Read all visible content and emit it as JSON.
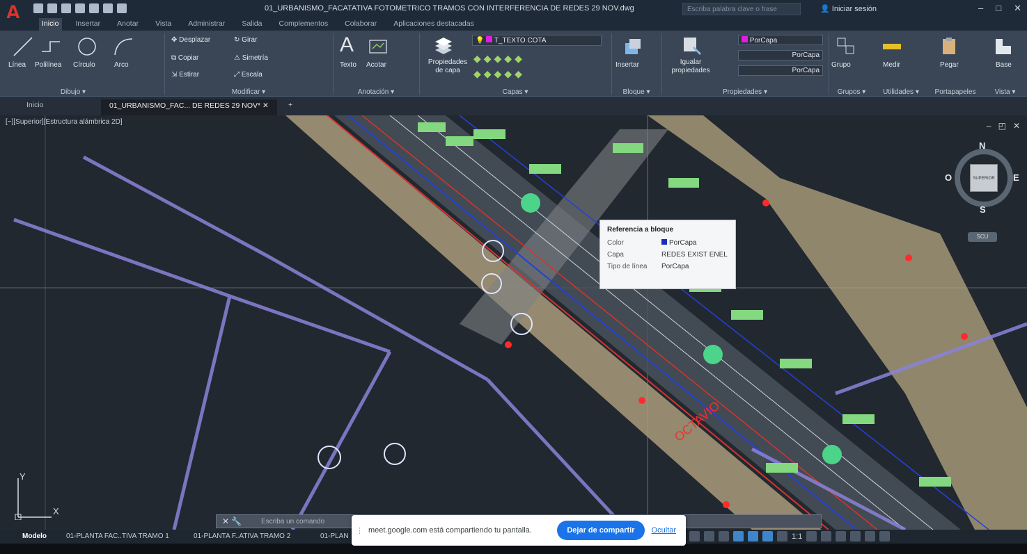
{
  "title_bar": {
    "document_title": "01_URBANISMO_FACATATIVA FOTOMETRICO TRAMOS CON INTERFERENCIA DE REDES 29 NOV.dwg",
    "search_placeholder": "Escriba palabra clave o frase",
    "signin_label": "Iniciar sesión"
  },
  "ribbon_tabs": [
    "Inicio",
    "Insertar",
    "Anotar",
    "Vista",
    "Administrar",
    "Salida",
    "Complementos",
    "Colaborar",
    "Aplicaciones destacadas"
  ],
  "ribbon": {
    "dibujo": {
      "title": "Dibujo ▾",
      "linea": "Línea",
      "polilinea": "Polilínea",
      "circulo": "Círculo",
      "arco": "Arco"
    },
    "modificar": {
      "title": "Modificar ▾",
      "desplazar": "Desplazar",
      "girar": "Girar",
      "copiar": "Copiar",
      "simetria": "Simetría",
      "estirar": "Estirar",
      "escala": "Escala"
    },
    "anotacion": {
      "title": "Anotación ▾",
      "texto": "Texto",
      "acotar": "Acotar"
    },
    "capas": {
      "title": "Capas ▾",
      "propiedades": "Propiedades de capa",
      "current_layer": "T_TEXTO COTA"
    },
    "bloque": {
      "title": "Bloque ▾",
      "insertar": "Insertar"
    },
    "propiedades": {
      "title": "Propiedades ▾",
      "igualar": "Igualar propiedades",
      "color": "PorCapa",
      "linetype": "PorCapa",
      "lineweight": "PorCapa"
    },
    "grupos": {
      "title": "Grupos ▾",
      "grupo": "Grupo"
    },
    "utilidades": {
      "title": "Utilidades ▾",
      "medir": "Medir"
    },
    "portapapeles": {
      "title": "Portapapeles",
      "pegar": "Pegar"
    },
    "vista": {
      "title": "Vista ▾",
      "base": "Base"
    }
  },
  "file_tabs": {
    "home": "Inicio",
    "active": "01_URBANISMO_FAC... DE REDES 29 NOV*"
  },
  "viewport": {
    "label": "[−][Superior][Estructura alámbrica 2D]",
    "compass": {
      "north": "N",
      "south": "S",
      "east": "E",
      "west": "O",
      "cube": "SUPERIOR",
      "wcs": "SCU"
    },
    "ucs_y": "Y",
    "ucs_x": "X"
  },
  "tooltip": {
    "title": "Referencia a bloque",
    "rows": [
      {
        "key": "Color",
        "value": "PorCapa"
      },
      {
        "key": "Capa",
        "value": "REDES EXIST ENEL"
      },
      {
        "key": "Tipo de línea",
        "value": "PorCapa"
      }
    ]
  },
  "command_line": {
    "placeholder": "Escriba un comando"
  },
  "layout_tabs": [
    "Modelo",
    "01-PLANTA FAC..TIVA TRAMO 1",
    "01-PLANTA F..ATIVA TRAMO 2",
    "01-PLAN"
  ],
  "status": {
    "scale": "1:1"
  },
  "share_banner": {
    "message": "meet.google.com está compartiendo tu pantalla.",
    "stop": "Dejar de compartir",
    "hide": "Ocultar"
  },
  "colors": {
    "ribbon": "#3a4656",
    "title_bar": "#1f2a38",
    "viewport": "#212830",
    "layer_swatch": "#e01ee0",
    "accent_blue": "#1a73e8"
  }
}
